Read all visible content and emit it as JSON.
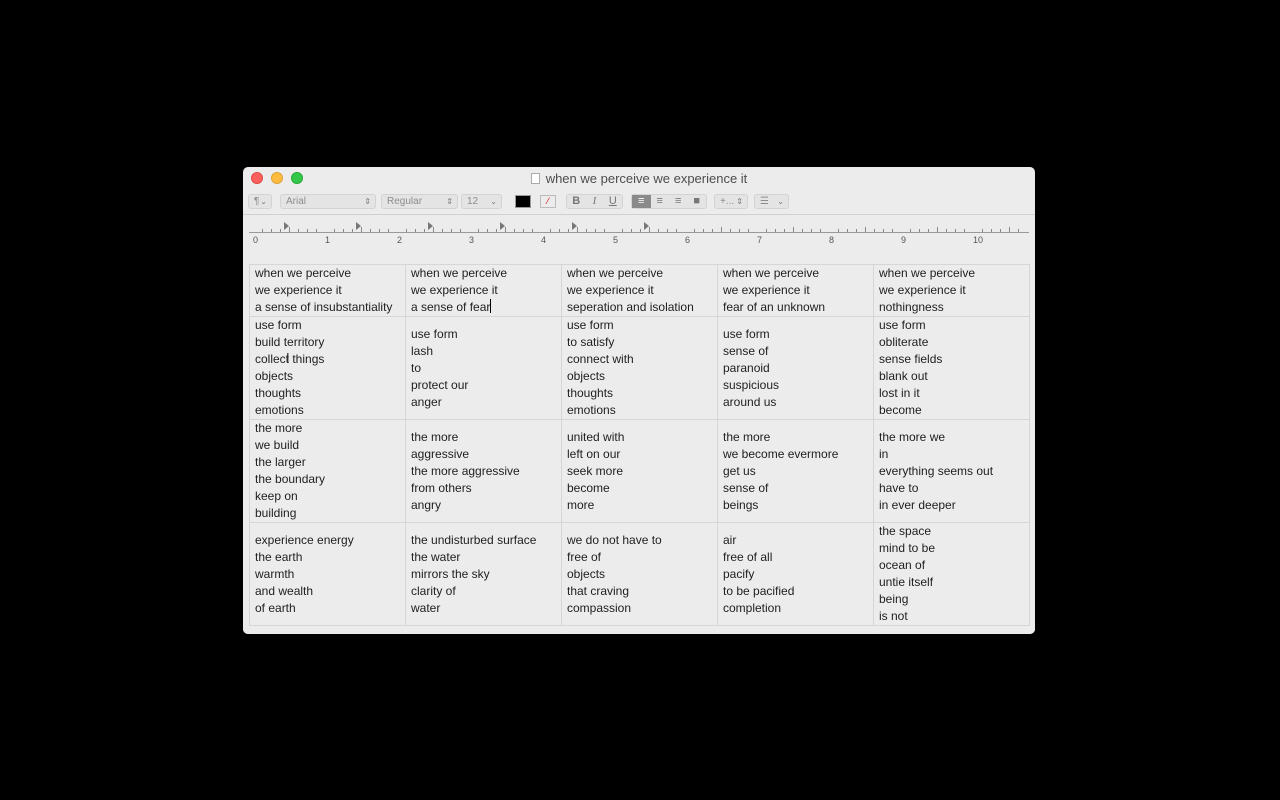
{
  "window": {
    "title": "when we perceive we experience it"
  },
  "toolbar": {
    "paragraph_style": "¶",
    "font_family": "Arial",
    "font_style": "Regular",
    "font_size": "12",
    "text_color": "#000000",
    "bold_label": "B",
    "italic_label": "I",
    "underline_label": "U",
    "alignment_selected": "left",
    "spacing_label": "+...",
    "list_label": "☰"
  },
  "ruler": {
    "numbers": [
      "0",
      "1",
      "2",
      "3",
      "4",
      "5",
      "6",
      "7",
      "8",
      "9",
      "10"
    ]
  },
  "table": {
    "rows": [
      [
        [
          "when we perceive",
          "we experience it",
          "a sense of insubstantiality"
        ],
        [
          "when we perceive",
          "we experience it",
          "a sense of fear"
        ],
        [
          "when we perceive",
          "we experience it",
          "seperation and isolation"
        ],
        [
          "when we perceive",
          "we experience it",
          "fear of an unknown"
        ],
        [
          "when we perceive",
          "we experience it",
          "nothingness"
        ]
      ],
      [
        [
          "use form",
          "build territory",
          "collect things",
          "objects",
          "thoughts",
          "emotions"
        ],
        [
          "use form",
          "lash",
          "to",
          "protect our",
          "anger"
        ],
        [
          "use form",
          "to satisfy",
          "connect with",
          "objects",
          "thoughts",
          "emotions"
        ],
        [
          "use form",
          "sense of",
          "paranoid",
          "suspicious",
          "around us"
        ],
        [
          "use form",
          "obliterate",
          "sense fields",
          "blank out",
          "lost in it",
          "become"
        ]
      ],
      [
        [
          "the more",
          "we build",
          "the larger",
          "the boundary",
          "keep on",
          "building"
        ],
        [
          "the more",
          "aggressive",
          "the more aggressive",
          "from others",
          "angry"
        ],
        [
          "united with",
          "left on our",
          "seek more",
          "become",
          "more"
        ],
        [
          "the more",
          "we become evermore",
          "get us",
          "sense of",
          "beings"
        ],
        [
          "the more we",
          "in",
          "everything seems out",
          "have to",
          "in ever deeper"
        ]
      ],
      [
        [
          "experience energy",
          "the earth",
          "warmth",
          "and wealth",
          "of earth"
        ],
        [
          "the undisturbed surface",
          "the water",
          "mirrors the sky",
          "clarity of",
          "water"
        ],
        [
          "we do not have to",
          "free of",
          "objects",
          "that craving",
          "compassion"
        ],
        [
          "air",
          "free of all",
          "pacify",
          "to be pacified",
          "completion"
        ],
        [
          "the space",
          "mind to be",
          "ocean of",
          "untie itself",
          "being",
          "is not"
        ]
      ]
    ]
  }
}
